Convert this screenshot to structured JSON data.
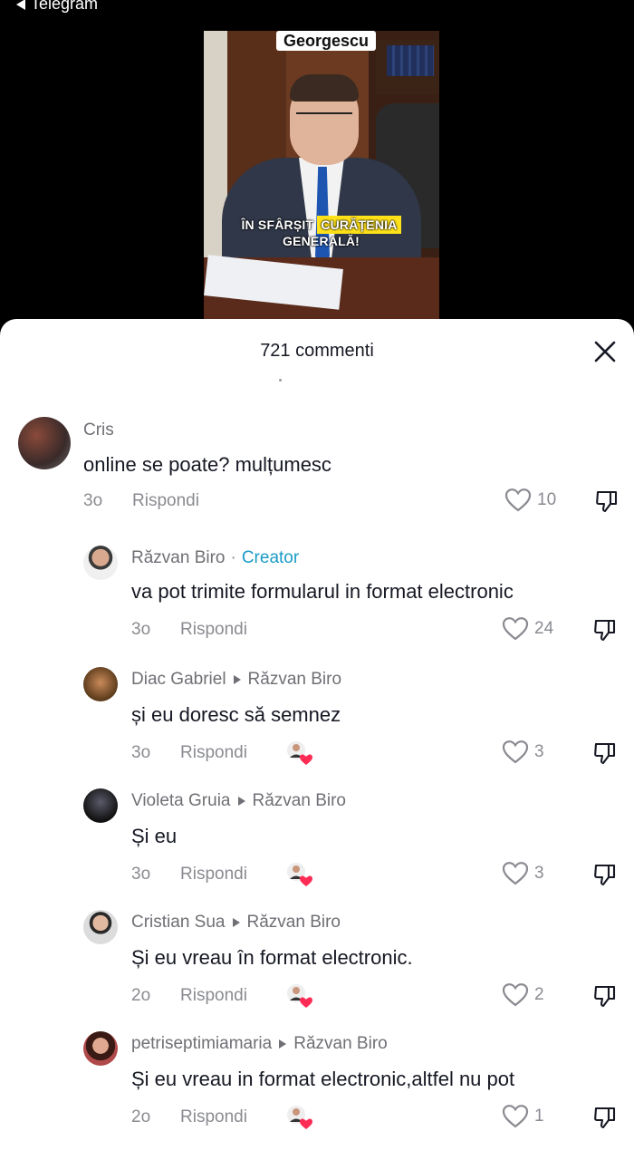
{
  "status_bar": {
    "back_label": "Telegram"
  },
  "video": {
    "name_tag": "Georgescu",
    "caption_part1": "ÎN SFÂRȘIT",
    "caption_highlight": "CURĂȚENIA",
    "caption_part2": "GENERALĂ!"
  },
  "panel": {
    "title": "721 commenti"
  },
  "reply_label": "Rispondi",
  "comments": [
    {
      "user": "Cris",
      "badge": "",
      "reply_to": "",
      "text": "online se poate? mulțumesc",
      "time": "3o",
      "likes": "10"
    },
    {
      "user": "Răzvan Biro",
      "badge": "Creator",
      "reply_to": "",
      "text": "va pot trimite formularul in format electronic",
      "time": "3o",
      "likes": "24"
    },
    {
      "user": "Diac Gabriel",
      "badge": "",
      "reply_to": "Răzvan Biro",
      "text": "și eu doresc să semnez",
      "time": "3o",
      "likes": "3"
    },
    {
      "user": "Violeta Gruia",
      "badge": "",
      "reply_to": "Răzvan Biro",
      "text": "Și eu",
      "time": "3o",
      "likes": "3"
    },
    {
      "user": "Cristian Sua",
      "badge": "",
      "reply_to": "Răzvan Biro",
      "text": "Și eu vreau în format electronic.",
      "time": "2o",
      "likes": "2"
    },
    {
      "user": "petriseptimiamaria",
      "badge": "",
      "reply_to": "Răzvan Biro",
      "text": "Și eu vreau in format electronic,altfel nu pot",
      "time": "2o",
      "likes": "1"
    }
  ]
}
